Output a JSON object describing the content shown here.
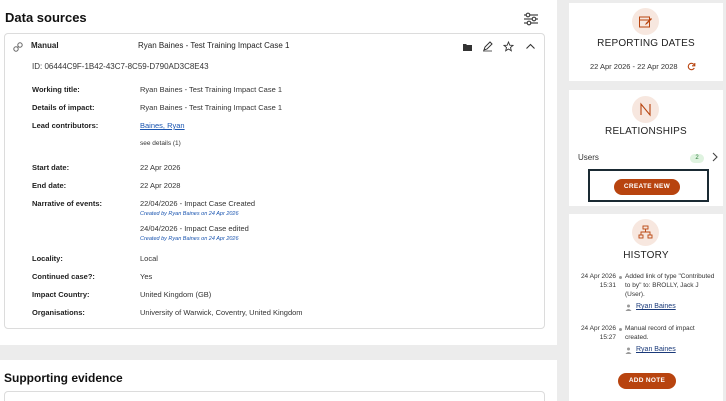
{
  "data_sources": {
    "title": "Data sources",
    "filter_icon": "sliders-icon",
    "record": {
      "source_type": "Manual",
      "title": "Ryan Baines - Test Training Impact Case 1",
      "id_line": "ID: 06444C9F-1B42-43C7-8C59-D790AD3C8E43",
      "working_title_label": "Working title:",
      "working_title": "Ryan Baines - Test Training Impact Case 1",
      "details_label": "Details of impact:",
      "details": "Ryan Baines - Test Training Impact Case 1",
      "lead_label": "Lead contributors:",
      "lead": "Baines, Ryan",
      "see_details": "see details (1)",
      "start_label": "Start date:",
      "start": "22 Apr 2026",
      "end_label": "End date:",
      "end": "22 Apr 2028",
      "narrative_label": "Narrative of events:",
      "narrative": [
        {
          "text": "22/04/2026 - Impact Case Created",
          "by": "Created by Ryan Baines on 24 Apr 2026"
        },
        {
          "text": "24/04/2026 - Impact Case edited",
          "by": "Created by Ryan Baines on 24 Apr 2026"
        }
      ],
      "locality_label": "Locality:",
      "locality": "Local",
      "continued_label": "Continued case?:",
      "continued": "Yes",
      "country_label": "Impact Country:",
      "country": "United Kingdom (GB)",
      "orgs_label": "Organisations:",
      "orgs": "University of Warwick, Coventry, United Kingdom"
    }
  },
  "supporting_evidence": {
    "title": "Supporting evidence"
  },
  "reporting_dates": {
    "heading": "REPORTING DATES",
    "range": "22 Apr 2026 - 22 Apr 2028"
  },
  "relationships": {
    "heading": "RELATIONSHIPS",
    "users_label": "Users",
    "users_count": "2",
    "create_button": "CREATE NEW"
  },
  "history": {
    "heading": "HISTORY",
    "entries": [
      {
        "date": "24 Apr 2026",
        "time": "15:31",
        "text": "Added link of type \"Contributed to by\" to: BROLLY, Jack J (User).",
        "user": "Ryan Baines"
      },
      {
        "date": "24 Apr 2026",
        "time": "15:27",
        "text": "Manual record of impact created.",
        "user": "Ryan Baines"
      }
    ],
    "add_button": "ADD NOTE"
  },
  "colors": {
    "accent": "#b8440f",
    "link": "#1a55b0",
    "icon_bg": "#f7e7df"
  }
}
